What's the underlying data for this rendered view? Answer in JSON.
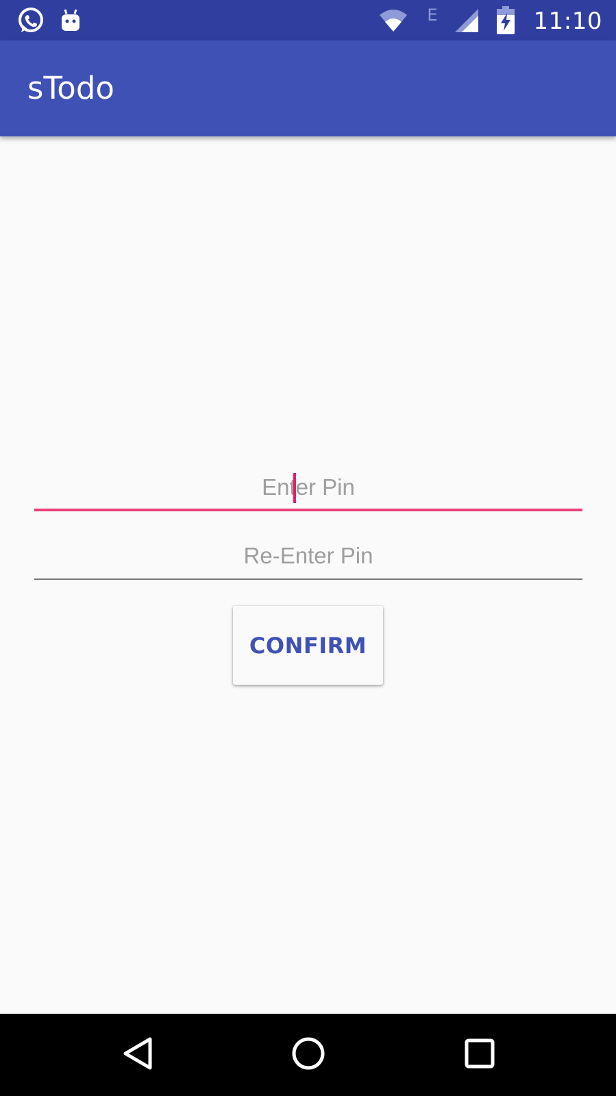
{
  "status_bar": {
    "time": "11:10",
    "network_type": "E",
    "icons": [
      "whatsapp-icon",
      "android-icon",
      "wifi-icon",
      "cell-signal-icon",
      "battery-charging-icon"
    ]
  },
  "app_bar": {
    "title": "sTodo"
  },
  "form": {
    "pin": {
      "placeholder": "Enter Pin",
      "value": ""
    },
    "repin": {
      "placeholder": "Re-Enter Pin",
      "value": ""
    },
    "confirm_label": "CONFIRM"
  },
  "nav_bar": {
    "icons": [
      "back-icon",
      "home-icon",
      "recents-icon"
    ]
  },
  "colors": {
    "status_bar": "#303f9f",
    "primary": "#3f51b5",
    "accent": "#ec407a",
    "background": "#fafafa",
    "nav_bar": "#000000"
  }
}
